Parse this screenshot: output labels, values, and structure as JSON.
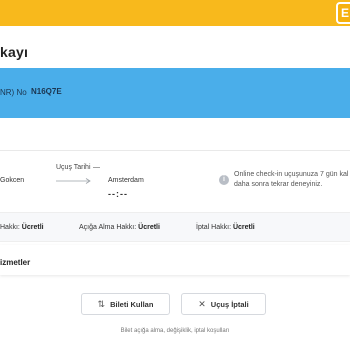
{
  "header": {
    "title": "kayı",
    "edge_button_label": "E"
  },
  "pnr": {
    "label": "NR) No",
    "value": "N16Q7E"
  },
  "flight": {
    "origin": "Gokcen",
    "date_label": "Uçuş Tarihi",
    "date_value": "—",
    "destination": "Amsterdam",
    "time": "--:--"
  },
  "info": {
    "icon": "info-icon",
    "message": "Online check-in uçuşunuza 7 gün kal daha sonra tekrar deneyiniz."
  },
  "rights": [
    {
      "label": "Hakkı:",
      "value": "Ücretli"
    },
    {
      "label": "Açığa Alma Hakkı:",
      "value": "Ücretli"
    },
    {
      "label": "İptal Hakkı:",
      "value": "Ücretli"
    }
  ],
  "services": {
    "title": "izmetler"
  },
  "actions": {
    "use_ticket": {
      "label": "Bileti Kullan",
      "icon": "swap-icon"
    },
    "cancel_flight": {
      "label": "Uçuş İptali",
      "icon": "close-icon"
    }
  },
  "footnote": "Bilet açığa alma, değişiklik, iptal koşulları",
  "colors": {
    "topbar": "#f8b91c",
    "pnr_bar": "#4aaeea"
  }
}
